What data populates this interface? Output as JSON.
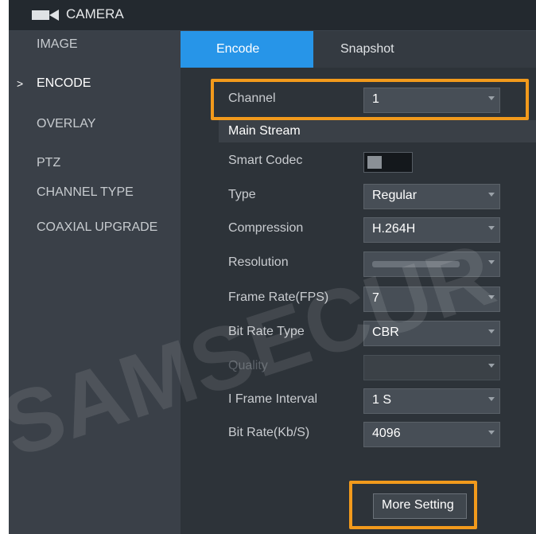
{
  "colors": {
    "accent_tab": "#2795e8",
    "highlight": "#f29a1c",
    "background": "#1c2228"
  },
  "header": {
    "title": "CAMERA",
    "icon": "camera-icon"
  },
  "sidebar": {
    "items": [
      {
        "label": "IMAGE",
        "active": false
      },
      {
        "label": "ENCODE",
        "active": true
      },
      {
        "label": "OVERLAY",
        "active": false
      },
      {
        "label": "PTZ",
        "active": false
      },
      {
        "label": "CHANNEL TYPE",
        "active": false
      },
      {
        "label": "COAXIAL UPGRADE",
        "active": false
      }
    ],
    "active_marker": ">"
  },
  "tabs": [
    {
      "label": "Encode",
      "active": true
    },
    {
      "label": "Snapshot",
      "active": false
    }
  ],
  "form": {
    "channel": {
      "label": "Channel",
      "value": "1"
    },
    "section_title": "Main Stream",
    "smart_codec": {
      "label": "Smart Codec"
    },
    "type": {
      "label": "Type",
      "value": "Regular"
    },
    "compression": {
      "label": "Compression",
      "value": "H.264H"
    },
    "resolution": {
      "label": "Resolution"
    },
    "frame_rate": {
      "label": "Frame Rate(FPS)",
      "value": "7"
    },
    "bit_rate_type": {
      "label": "Bit Rate Type",
      "value": "CBR"
    },
    "quality": {
      "label": "Quality",
      "value": ""
    },
    "i_frame_interval": {
      "label": "I Frame Interval",
      "value": "1 S"
    },
    "bit_rate": {
      "label": "Bit Rate(Kb/S)",
      "value": "4096"
    },
    "more_setting_label": "More Setting"
  },
  "watermark": {
    "text": "SAMSECUR"
  }
}
